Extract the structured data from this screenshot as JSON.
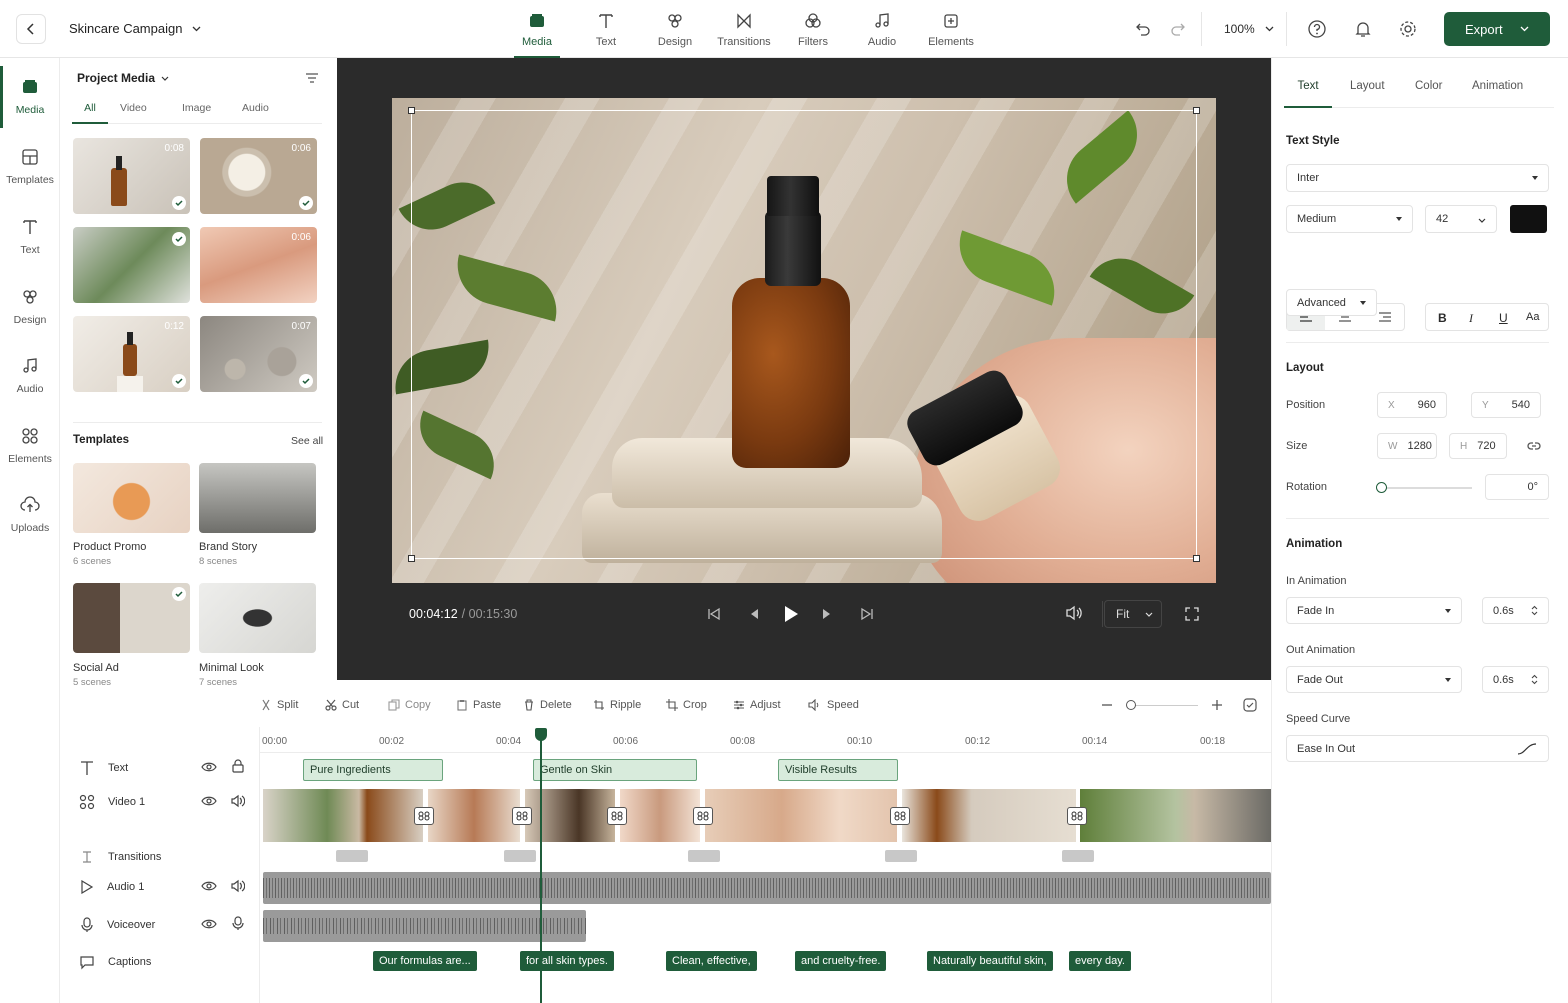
{
  "header": {
    "project_name": "Skincare Campaign",
    "zoom": "100%",
    "export_label": "Export",
    "nav": [
      "Media",
      "Text",
      "Design",
      "Transitions",
      "Filters",
      "Audio",
      "Elements"
    ],
    "active_nav": "Media"
  },
  "rail": {
    "items": [
      "Media",
      "Templates",
      "Text",
      "Design",
      "Audio",
      "Elements",
      "Uploads"
    ]
  },
  "media_panel": {
    "title": "Project Media",
    "tabs": [
      "All",
      "Video",
      "Image",
      "Audio"
    ],
    "thumbs": [
      {
        "duration": "0:08",
        "checked": true
      },
      {
        "duration": "0:06",
        "checked": true
      },
      {
        "duration": "",
        "checked": true
      },
      {
        "duration": "0:06",
        "checked": false
      },
      {
        "duration": "0:12",
        "checked": true
      },
      {
        "duration": "0:07",
        "checked": true
      }
    ],
    "templates_title": "Templates",
    "see_all": "See all",
    "templates": [
      {
        "name": "Product Promo",
        "scenes": "6 scenes"
      },
      {
        "name": "Brand Story",
        "scenes": "8 scenes"
      },
      {
        "name": "Social Ad",
        "scenes": "5 scenes"
      },
      {
        "name": "Minimal Look",
        "scenes": "7 scenes"
      }
    ]
  },
  "player": {
    "current_time": "00:04:12",
    "total_time": "/ 00:15:30",
    "fit": "Fit"
  },
  "inspector": {
    "tabs": [
      "Text",
      "Layout",
      "Color",
      "Animation"
    ],
    "active_tab": "Text",
    "text_style_title": "Text Style",
    "font": "Inter",
    "weight": "Medium",
    "size": "42",
    "color": "#111111",
    "format_labels": {
      "bold": "B",
      "italic": "I",
      "underline": "U",
      "case": "Aa"
    },
    "advanced": "Advanced",
    "layout_title": "Layout",
    "position_label": "Position",
    "x_label": "X",
    "x": "960",
    "y_label": "Y",
    "y": "540",
    "size_label": "Size",
    "w_label": "W",
    "w": "1280",
    "h_label": "H",
    "h": "720",
    "rotation_label": "Rotation",
    "rotation": "0°",
    "animation_title": "Animation",
    "in_label": "In Animation",
    "in_value": "Fade In",
    "in_duration": "0.6s",
    "out_label": "Out Animation",
    "out_value": "Fade Out",
    "out_duration": "0.6s",
    "curve_label": "Speed Curve",
    "curve_value": "Ease In Out"
  },
  "timeline": {
    "tools": [
      "Split",
      "Cut",
      "Copy",
      "Paste",
      "Delete",
      "Ripple",
      "Crop",
      "Adjust",
      "Speed"
    ],
    "ruler": [
      "00:00",
      "00:02",
      "00:04",
      "00:06",
      "00:08",
      "00:10",
      "00:12",
      "00:14",
      "00:18"
    ],
    "tracks": [
      "Text",
      "Video 1",
      "Transitions",
      "Audio 1",
      "Voiceover",
      "Captions"
    ],
    "text_clips": [
      "Pure Ingredients",
      "Gentle on Skin",
      "Visible Results"
    ],
    "captions": [
      "Our formulas are...",
      "for all skin types.",
      "Clean, effective,",
      "and cruelty-free.",
      "Naturally beautiful skin,",
      "every day."
    ]
  },
  "colors": {
    "accent": "#1f5c3a",
    "preview_bg": "#2b2b2b"
  }
}
